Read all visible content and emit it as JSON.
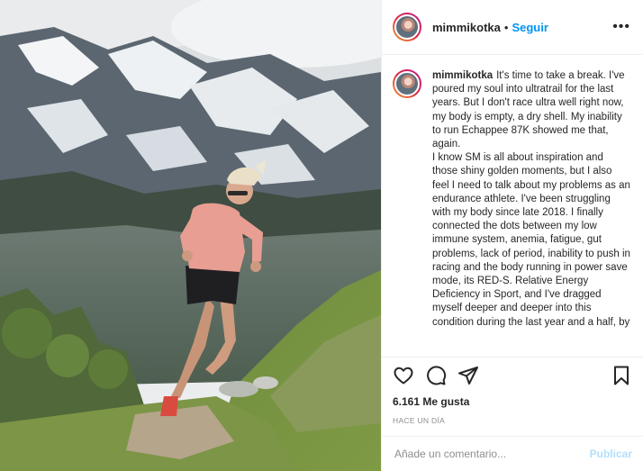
{
  "post": {
    "username": "mimmikotka",
    "separator": "•",
    "follow_label": "Seguir",
    "more_label": "•••"
  },
  "caption": {
    "username": "mimmikotka",
    "paragraphs": [
      "It's time to take a break. I've poured my soul into ultratrail for the last years. But I don't race ultra well right now, my body is empty, a dry shell. My inability to run Echappee 87K showed me that, again.",
      "I know SM is all about inspiration and those shiny golden moments, but I also feel I need to talk about my problems as an endurance athlete. I've been struggling with my body since late 2018. I finally connected the dots between my low immune system, anemia, fatigue, gut problems, lack of period, inability to push in racing and the body running in power save mode, its RED-S. Relative Energy Deficiency in Sport, and I've dragged myself deeper and deeper into this condition during the last year and a half, by"
    ]
  },
  "actions": {
    "like_icon": "heart-icon",
    "comment_icon": "comment-icon",
    "share_icon": "paper-plane-icon",
    "save_icon": "bookmark-icon"
  },
  "likes_text": "6.161 Me gusta",
  "time_text": "HACE UN DÍA",
  "comment": {
    "placeholder": "Añade un comentario...",
    "post_label": "Publicar"
  },
  "colors": {
    "link": "#0095f6",
    "post_disabled": "#b2dffc",
    "muted": "#8e8e8e",
    "border": "#efefef"
  }
}
